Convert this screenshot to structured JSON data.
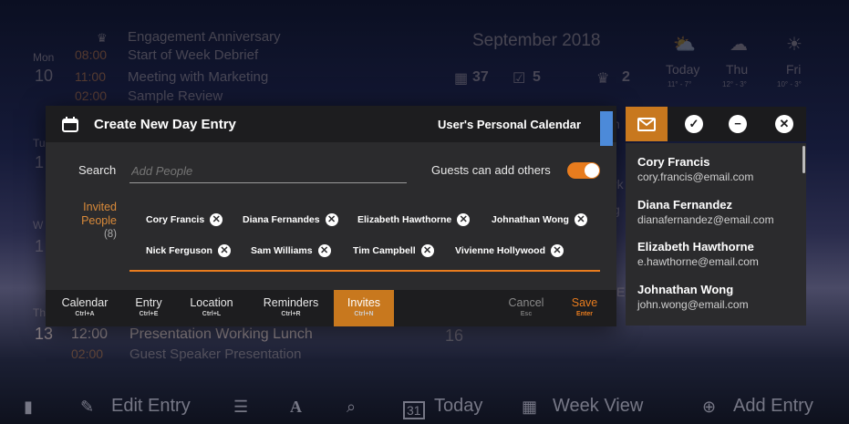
{
  "background": {
    "day1": {
      "dow": "Mon",
      "num": "10"
    },
    "events1": [
      {
        "time": "",
        "title": "Engagement Anniversary"
      },
      {
        "time": "08:00",
        "title": "Start of Week Debrief"
      },
      {
        "time": "11:00",
        "title": "Meeting with Marketing"
      },
      {
        "time": "02:00",
        "title": "Sample Review"
      }
    ],
    "month_title": "September 2018",
    "stats": [
      {
        "icon": "calendar-icon",
        "value": "37"
      },
      {
        "icon": "checklist-icon",
        "value": "5"
      },
      {
        "icon": "cake-icon",
        "value": "2"
      }
    ],
    "weather": [
      {
        "icon": "partly-sunny-icon",
        "label": "Today",
        "temp": "11° - 7°"
      },
      {
        "icon": "cloudy-icon",
        "label": "Thu",
        "temp": "12° - 3°"
      },
      {
        "icon": "sunny-icon",
        "label": "Fri",
        "temp": "10° - 3°"
      }
    ],
    "day_partial_a": "Tu",
    "day_partial_b": "1",
    "day_partial_c": "W",
    "day_partial_d": "1",
    "day2": {
      "dow": "Th",
      "num": "13"
    },
    "events2": [
      {
        "time": "12:00",
        "title": "Presentation Working Lunch"
      },
      {
        "time": "02:00",
        "title": "Guest Speaker Presentation"
      }
    ],
    "other_day_num": "16",
    "partial_letters": [
      "n",
      "rk",
      "g",
      "E"
    ]
  },
  "modal": {
    "title": "Create New Day Entry",
    "calendar_name": "User's Personal Calendar",
    "search_label": "Search",
    "search_placeholder": "Add People",
    "guests_label": "Guests can add others",
    "guests_toggle_on": true,
    "invited_label_1": "Invited",
    "invited_label_2": "People",
    "invited_count": "(8)",
    "invitees": [
      "Cory Francis",
      "Diana Fernandes",
      "Elizabeth Hawthorne",
      "Johnathan Wong",
      "Nick Ferguson",
      "Sam Williams",
      "Tim Campbell",
      "Vivienne Hollywood"
    ],
    "tabs": [
      {
        "label": "Calendar",
        "shortcut": "Ctrl+A"
      },
      {
        "label": "Entry",
        "shortcut": "Ctrl+E"
      },
      {
        "label": "Location",
        "shortcut": "Ctrl+L"
      },
      {
        "label": "Reminders",
        "shortcut": "Ctrl+R"
      },
      {
        "label": "Invites",
        "shortcut": "Ctrl+N"
      }
    ],
    "cancel": {
      "label": "Cancel",
      "shortcut": "Esc"
    },
    "save": {
      "label": "Save",
      "shortcut": "Enter"
    }
  },
  "suggestions": [
    {
      "name": "Cory Francis",
      "email": "cory.francis@email.com"
    },
    {
      "name": "Diana Fernandez",
      "email": "dianafernandez@email.com"
    },
    {
      "name": "Elizabeth Hawthorne",
      "email": "e.hawthorne@email.com"
    },
    {
      "name": "Johnathan Wong",
      "email": "john.wong@email.com"
    }
  ],
  "toolbar": {
    "edit_entry": "Edit Entry",
    "today": "Today",
    "today_icon_num": "31",
    "week_view": "Week View",
    "add_entry": "Add Entry"
  },
  "colors": {
    "accent": "#c8781e",
    "toggle": "#e87c1e",
    "blue": "#4c8ad9"
  }
}
